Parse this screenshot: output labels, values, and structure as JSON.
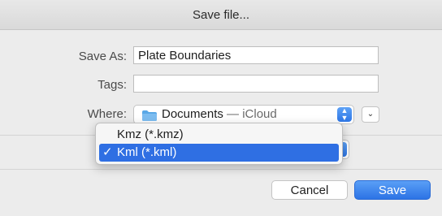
{
  "window": {
    "title": "Save file..."
  },
  "form": {
    "save_as_label": "Save As:",
    "save_as_value": "Plate Boundaries",
    "tags_label": "Tags:",
    "tags_value": "",
    "where_label": "Where:",
    "where_location": "Documents",
    "where_separator": " — ",
    "where_service": "iCloud"
  },
  "format_menu": {
    "items": [
      {
        "label": "Kmz (*.kmz)",
        "selected": false,
        "check": ""
      },
      {
        "label": "Kml (*.kml)",
        "selected": true,
        "check": "✓"
      }
    ]
  },
  "buttons": {
    "cancel": "Cancel",
    "save": "Save"
  },
  "colors": {
    "accent": "#2f6fe3",
    "folder": "#5aa8e6"
  },
  "icons": {
    "stepper": "stepper-icon",
    "disclosure": "chevron-down-icon",
    "folder": "folder-icon",
    "check": "checkmark-icon"
  }
}
